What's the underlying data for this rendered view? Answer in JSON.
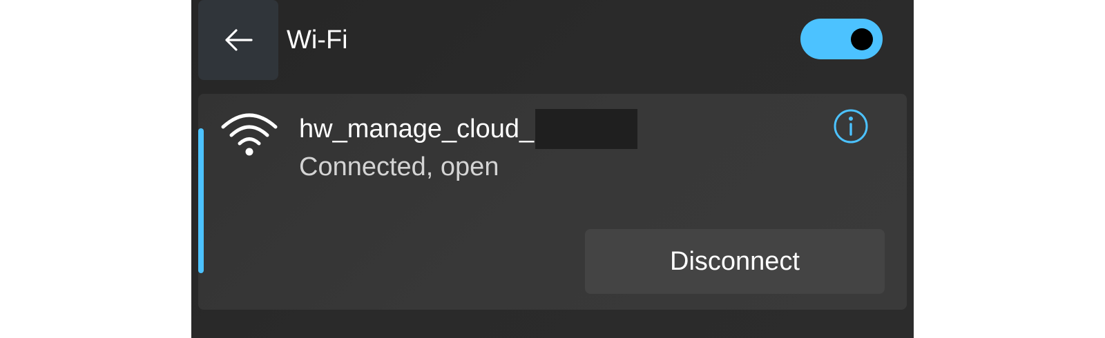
{
  "header": {
    "back_icon": "arrow-left-icon",
    "title": "Wi-Fi",
    "toggle_state": "on"
  },
  "network": {
    "icon": "wifi-signal-icon",
    "name": "hw_manage_cloud_",
    "status": "Connected, open",
    "info_icon": "info-icon",
    "disconnect_label": "Disconnect"
  },
  "colors": {
    "accent": "#4cc2ff",
    "panel_bg": "#2a2a2a",
    "card_bg": "#363636",
    "button_bg": "#444444",
    "text_primary": "#ffffff",
    "text_secondary": "#d4d4d4"
  }
}
